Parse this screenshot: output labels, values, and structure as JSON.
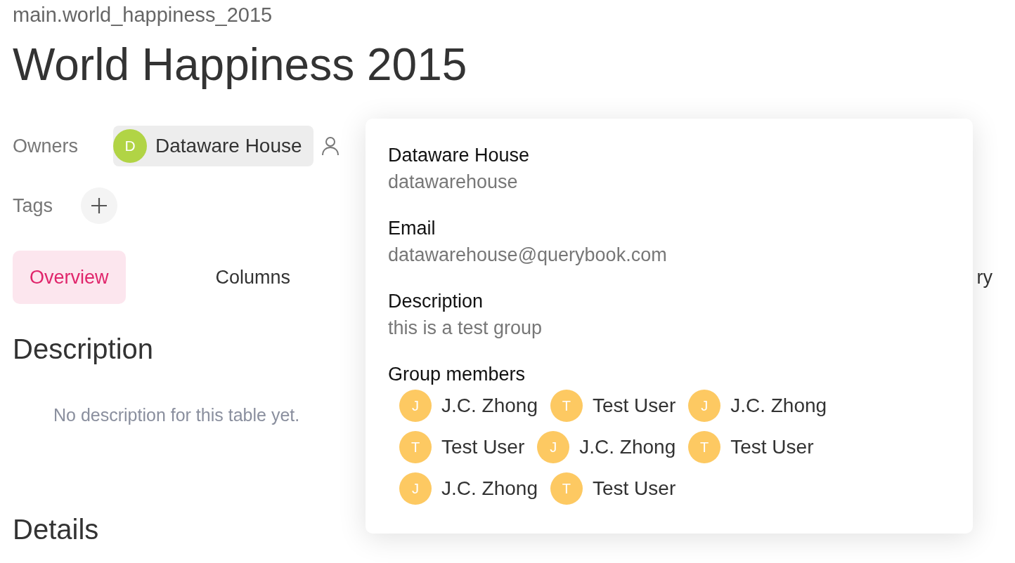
{
  "breadcrumb": "main.world_happiness_2015",
  "title": "World Happiness 2015",
  "owners": {
    "label": "Owners",
    "items": [
      {
        "initial": "D",
        "name": "Dataware House",
        "color": "#b1d445"
      }
    ]
  },
  "tags": {
    "label": "Tags"
  },
  "tabs": [
    {
      "label": "Overview",
      "selected": true
    },
    {
      "label": "Columns",
      "selected": false
    },
    {
      "label": "ry",
      "selected": false
    }
  ],
  "description": {
    "heading": "Description",
    "empty_text": "No description for this table yet."
  },
  "details": {
    "heading": "Details"
  },
  "popover": {
    "name": "Dataware House",
    "username": "datawarehouse",
    "fields": [
      {
        "label": "Email",
        "value": "datawarehouse@querybook.com"
      },
      {
        "label": "Description",
        "value": "this is a test group"
      }
    ],
    "members_label": "Group members",
    "members": [
      {
        "initial": "J",
        "name": "J.C. Zhong"
      },
      {
        "initial": "T",
        "name": "Test User"
      },
      {
        "initial": "J",
        "name": "J.C. Zhong"
      },
      {
        "initial": "T",
        "name": "Test User"
      },
      {
        "initial": "J",
        "name": "J.C. Zhong"
      },
      {
        "initial": "T",
        "name": "Test User"
      },
      {
        "initial": "J",
        "name": "J.C. Zhong"
      },
      {
        "initial": "T",
        "name": "Test User"
      }
    ]
  }
}
